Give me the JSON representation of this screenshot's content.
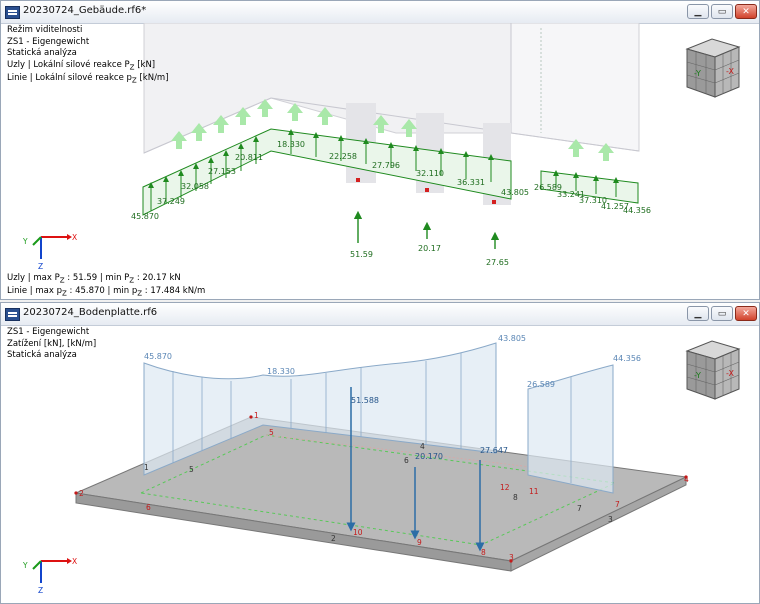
{
  "colors": {
    "load": "#1f8a1f",
    "load_light": "#9fe39f",
    "result": "#2c6da6",
    "plate": "#b5b5b5",
    "node": "#c41a1a"
  },
  "window_buttons": {
    "minimize": "▁",
    "restore": "▭",
    "close": "✕"
  },
  "axes": {
    "x": "X",
    "y": "Y",
    "z": "Z"
  },
  "cube": {
    "face_minus_y": "-Y",
    "face_x": "-X"
  },
  "top_window": {
    "title": "20230724_Gebäude.rf6*",
    "info": {
      "mode": "Režim viditelnosti",
      "loadcase": "ZS1 - Eigengewicht",
      "analysis": "Statická analýza",
      "nodes_label": "Uzly | Lokální silové reakce P",
      "nodes_unit": " [kN]",
      "lines_label": "Linie | Lokální silové reakce p",
      "lines_unit": " [kN/m]"
    },
    "summary": {
      "nodes": "Uzly | max P",
      "nodes_value": " : 51.59 | min P",
      "nodes_value2": " : 20.17 kN",
      "lines": "Linie | max p",
      "lines_value": " : 45.870 | min p",
      "lines_value2": " : 17.484 kN/m"
    },
    "line_values": [
      "45.870",
      "37.249",
      "32.058",
      "27.153",
      "20.811",
      "18.330",
      "22.258",
      "27.796",
      "32.110",
      "36.331",
      "43.805",
      "26.589",
      "33.241",
      "37.310",
      "41.257",
      "44.356"
    ],
    "node_values": [
      "51.59",
      "20.17",
      "27.65"
    ]
  },
  "bottom_window": {
    "title": "20230724_Bodenplatte.rf6",
    "info": {
      "loadcase": "ZS1 - Eigengewicht",
      "loads": "Zatížení [kN], [kN/m]",
      "analysis": "Statická analýza"
    },
    "line_loads": [
      "45.870",
      "18.330",
      "43.805",
      "26.589",
      "44.356"
    ],
    "point_loads": [
      "51.588",
      "20.170",
      "27.647"
    ],
    "node_numbers": [
      "1",
      "2",
      "3",
      "4",
      "5",
      "6",
      "7",
      "8",
      "9",
      "10",
      "11",
      "12"
    ],
    "line_numbers": [
      "1",
      "2",
      "3",
      "4",
      "5",
      "6",
      "7",
      "8"
    ]
  }
}
